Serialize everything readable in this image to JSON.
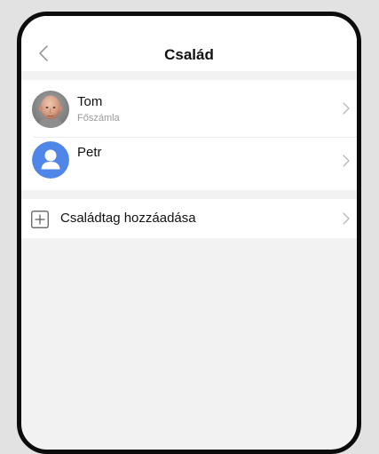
{
  "header": {
    "title": "Család",
    "back_icon": "chevron-left-icon"
  },
  "members": [
    {
      "name": "Tom",
      "subtitle": "Főszámla",
      "avatar": "photo"
    },
    {
      "name": "Petr",
      "subtitle": "",
      "avatar": "person-icon"
    }
  ],
  "add_member": {
    "label": "Családtag hozzáadása",
    "icon": "plus-square-icon"
  },
  "colors": {
    "accent": "#4f86e8",
    "background": "#f2f2f2",
    "frame": "#0c0c0c"
  }
}
